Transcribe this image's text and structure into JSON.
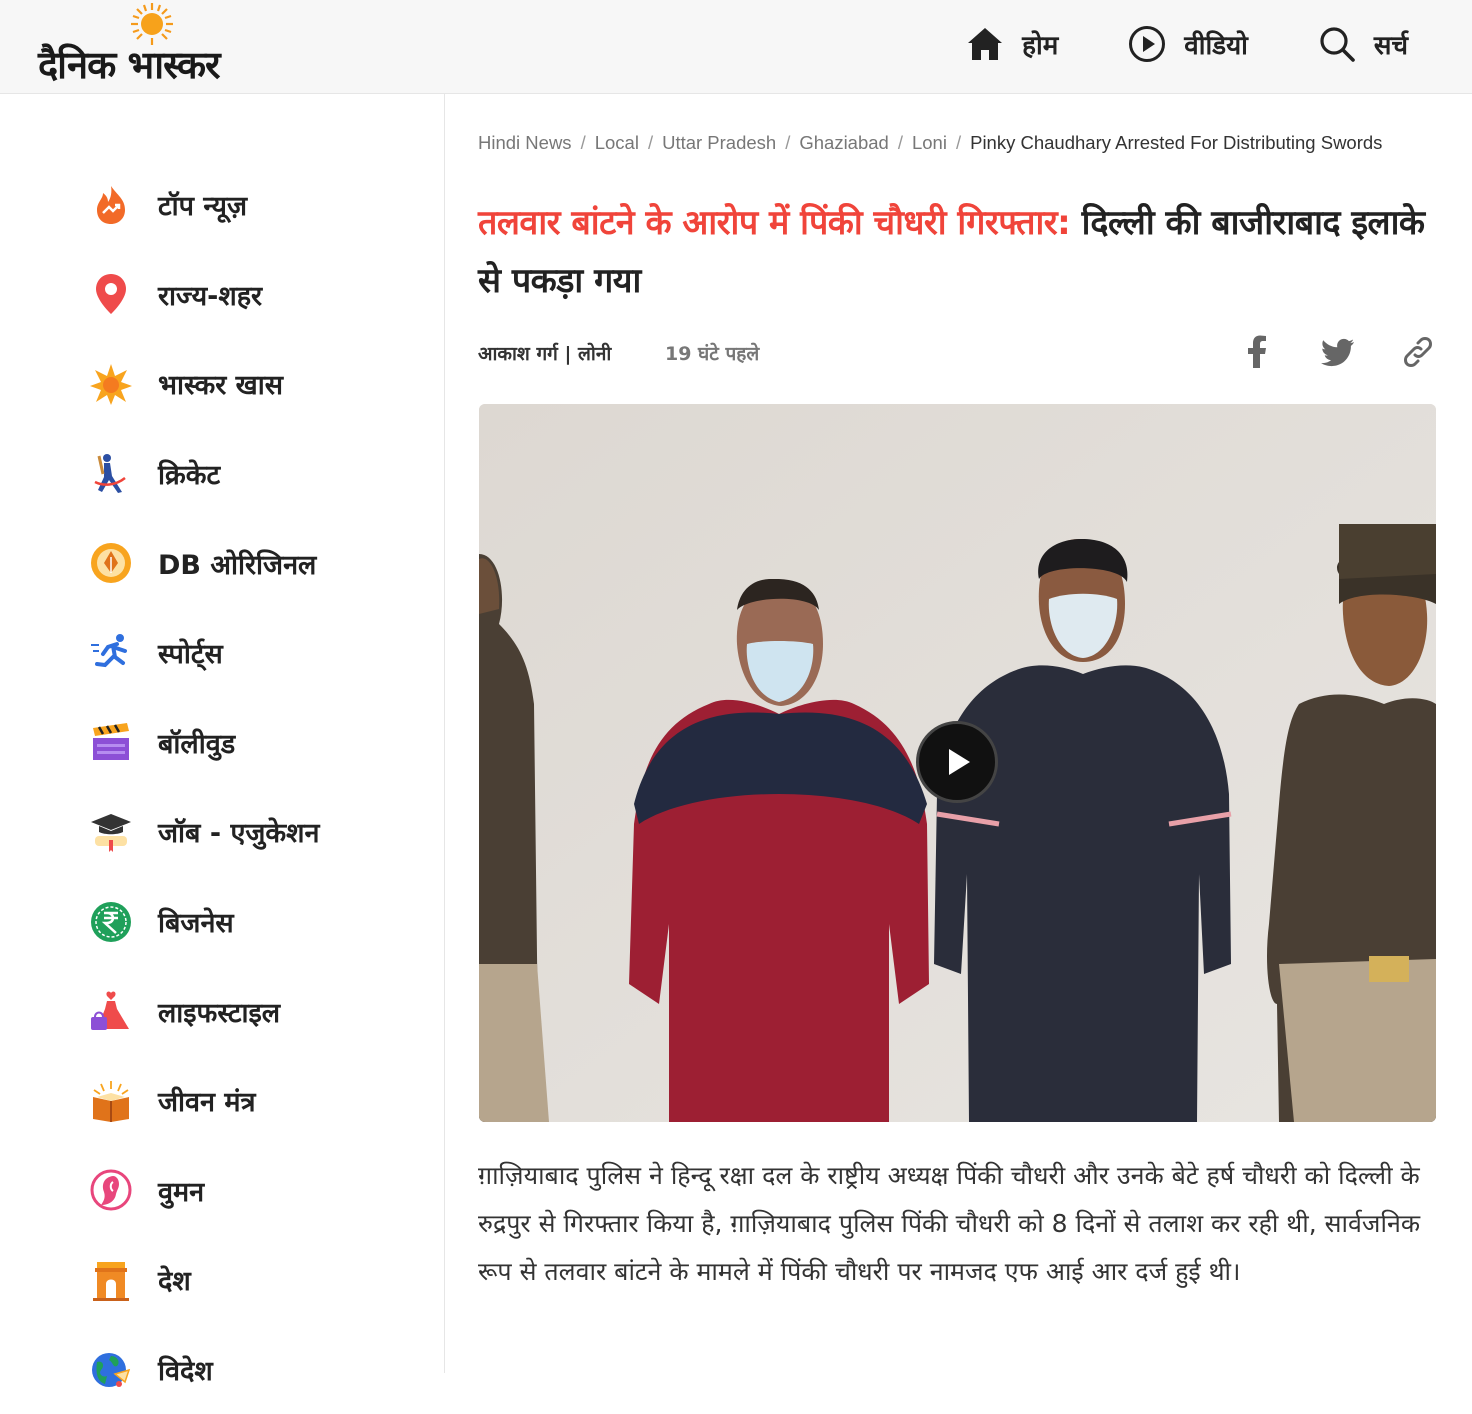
{
  "header": {
    "logo_text": "दैनिक भास्कर",
    "nav": [
      {
        "label": "होम",
        "icon": "home-icon"
      },
      {
        "label": "वीडियो",
        "icon": "play-circle-icon"
      },
      {
        "label": "सर्च",
        "icon": "search-icon"
      }
    ]
  },
  "sidebar": {
    "items": [
      {
        "label": "टॉप न्यूज़",
        "icon": "fire-icon"
      },
      {
        "label": "राज्य-शहर",
        "icon": "location-pin-icon"
      },
      {
        "label": "भास्कर खास",
        "icon": "star-icon"
      },
      {
        "label": "क्रिकेट",
        "icon": "cricket-icon"
      },
      {
        "label": "DB ओरिजिनल",
        "icon": "pen-nib-icon"
      },
      {
        "label": "स्पोर्ट्स",
        "icon": "runner-icon"
      },
      {
        "label": "बॉलीवुड",
        "icon": "clapperboard-icon"
      },
      {
        "label": "जॉब - एजुकेशन",
        "icon": "graduation-cap-icon"
      },
      {
        "label": "बिजनेस",
        "icon": "rupee-icon"
      },
      {
        "label": "लाइफस्टाइल",
        "icon": "dress-icon"
      },
      {
        "label": "जीवन मंत्र",
        "icon": "book-icon"
      },
      {
        "label": "वुमन",
        "icon": "woman-icon"
      },
      {
        "label": "देश",
        "icon": "india-gate-icon"
      },
      {
        "label": "विदेश",
        "icon": "globe-icon"
      }
    ]
  },
  "breadcrumb": [
    "Hindi News",
    "Local",
    "Uttar Pradesh",
    "Ghaziabad",
    "Loni",
    "Pinky Chaudhary Arrested For Distributing Swords"
  ],
  "article": {
    "headline_highlight": "तलवार बांटने के आरोप में पिंकी चौधरी गिरफ्तार:",
    "headline_rest": " दिल्ली की बाजीराबाद इलाके से पकड़ा गया",
    "author": "आकाश गर्ग | लोनी",
    "time": "19 घंटे पहले",
    "share": [
      "facebook-icon",
      "twitter-icon",
      "link-icon"
    ],
    "body": "ग़ाज़ियाबाद पुलिस ने हिन्दू रक्षा दल के राष्ट्रीय अध्यक्ष पिंकी चौधरी और उनके बेटे हर्ष चौधरी को दिल्ली के रुद्रपुर से गिरफ्तार किया है, ग़ाज़ियाबाद पुलिस पिंकी चौधरी को 8 दिनों से तलाश कर रही थी, सार्वजनिक रूप से तलवार बांटने के मामले में पिंकी चौधरी पर नामजद एफ आई आर दर्ज हुई थी।"
  },
  "colors": {
    "headline_accent": "#f0443a",
    "header_bg": "#f7f7f7",
    "text": "#222222"
  }
}
